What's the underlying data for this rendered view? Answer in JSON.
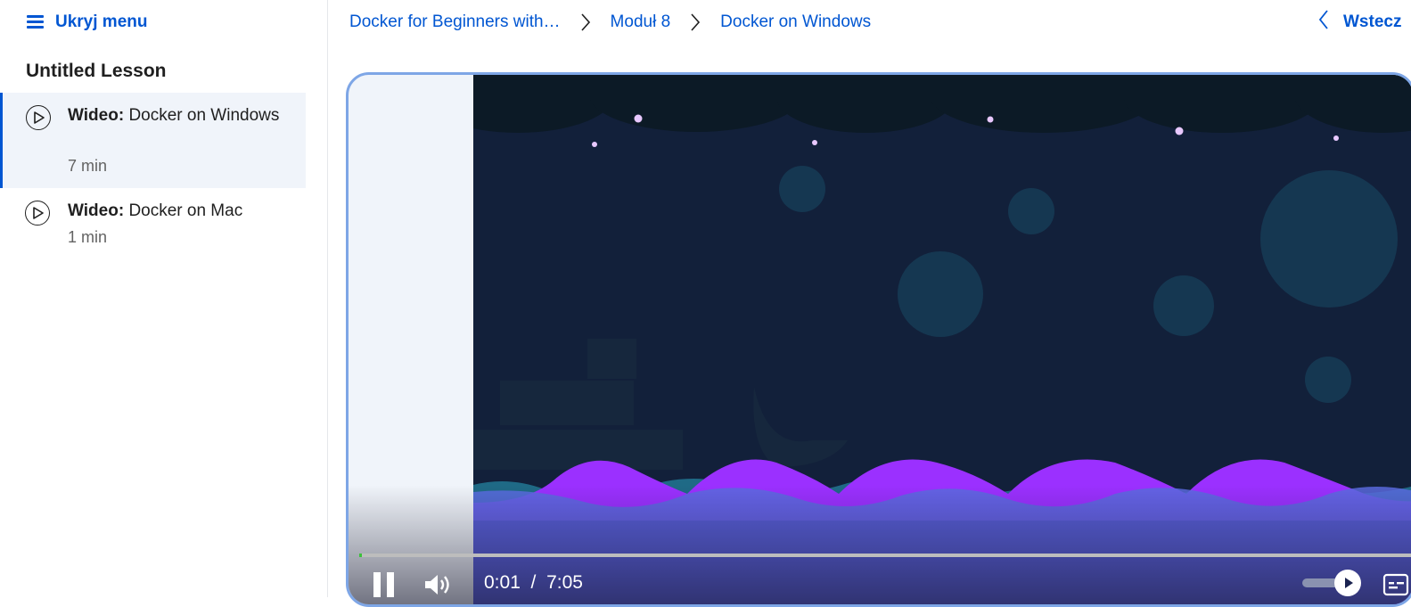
{
  "sidebar": {
    "hide_menu_label": "Ukryj menu",
    "lesson_title": "Untitled Lesson",
    "items": [
      {
        "kind": "Wideo:",
        "title": "Docker on Windows",
        "duration": "7 min",
        "active": true
      },
      {
        "kind": "Wideo:",
        "title": "Docker on Mac",
        "duration": "1 min",
        "active": false
      }
    ]
  },
  "breadcrumb": {
    "items": [
      "Docker for Beginners with…",
      "Moduł 8",
      "Docker on Windows"
    ]
  },
  "header": {
    "back_label": "Wstecz"
  },
  "player": {
    "current_time": "0:01",
    "separator": "/",
    "total_time": "7:05",
    "progress_fraction": 0.0024
  },
  "colors": {
    "accent": "#0056d2",
    "video_bg": "#12203a",
    "wave_purple": "#9b30ff",
    "wave_blue": "#5b6be0",
    "progress_played": "#3cc13b"
  }
}
